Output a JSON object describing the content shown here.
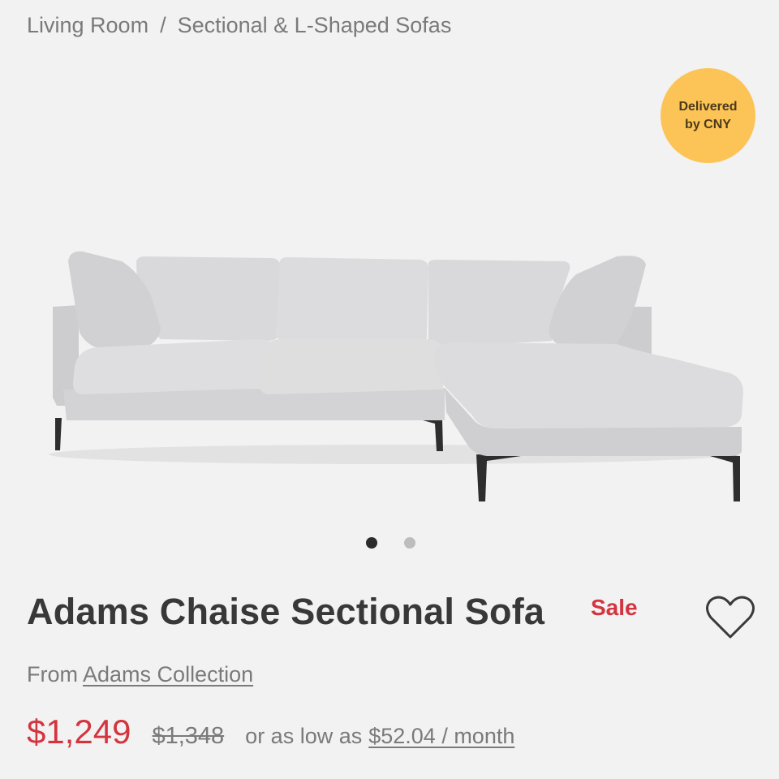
{
  "breadcrumb": {
    "items": [
      "Living Room",
      "Sectional & L-Shaped Sofas"
    ],
    "separator": "/"
  },
  "badge": {
    "line1": "Delivered",
    "line2": "by CNY",
    "color": "#fcc457"
  },
  "product": {
    "image_icon": "sofa-image",
    "carousel": {
      "total": 2,
      "active": 1
    },
    "title": "Adams Chaise Sectional Sofa",
    "sale_label": "Sale",
    "wishlist_icon": "heart-outline-icon",
    "from_label": "From",
    "collection": "Adams Collection",
    "price": "$1,249",
    "original_price": "$1,348",
    "financing_prefix": "or as low as",
    "financing_amount": "$52.04 / month"
  },
  "colors": {
    "accent": "#d4343f",
    "badge": "#fcc457",
    "text_dark": "#383838",
    "text_muted": "#7a7a7a"
  }
}
